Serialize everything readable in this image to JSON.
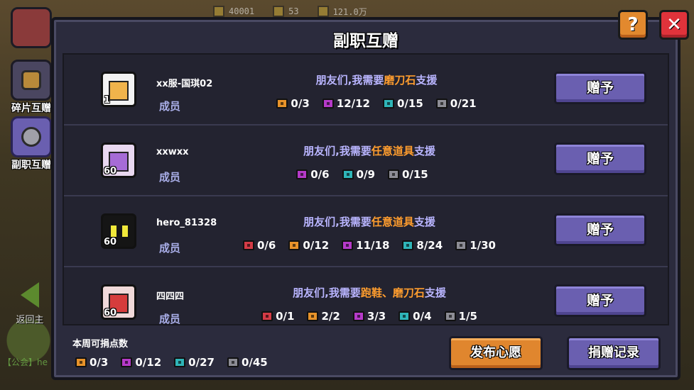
{
  "top_bar": {
    "resources": [
      {
        "icon": "gem-icon",
        "value": "40001"
      },
      {
        "icon": "key-icon",
        "value": "53"
      },
      {
        "icon": "coin-icon",
        "value": "121.0万"
      }
    ]
  },
  "side_tabs": [
    {
      "label": "碎片互赠",
      "icon": "shield-icon",
      "active": false
    },
    {
      "label": "副职互赠",
      "icon": "gear-stone-icon",
      "active": true
    }
  ],
  "back_label": "返回主",
  "guild_chat": "【公会】he",
  "dialog": {
    "title": "副职互赠",
    "rows": [
      {
        "name": "xx服-国琪02",
        "level": "1",
        "role": "成员",
        "need_prefix": "朋友们,我需要",
        "need_item": "磨刀石",
        "need_suffix": "支援",
        "counts": [
          {
            "color": "orange",
            "value": "0/3"
          },
          {
            "color": "purple",
            "value": "12/12"
          },
          {
            "color": "teal",
            "value": "0/15"
          },
          {
            "color": "gray",
            "value": "0/21"
          }
        ],
        "button": "赠予"
      },
      {
        "name": "xxwxx",
        "level": "60",
        "role": "成员",
        "need_prefix": "朋友们,我需要",
        "need_item": "任意道具",
        "need_suffix": "支援",
        "counts": [
          {
            "color": "purple",
            "value": "0/6"
          },
          {
            "color": "teal",
            "value": "0/9"
          },
          {
            "color": "gray",
            "value": "0/15"
          }
        ],
        "button": "赠予"
      },
      {
        "name": "hero_81328",
        "level": "60",
        "role": "成员",
        "need_prefix": "朋友们,我需要",
        "need_item": "任意道具",
        "need_suffix": "支援",
        "counts": [
          {
            "color": "red",
            "value": "0/6"
          },
          {
            "color": "orange",
            "value": "0/12"
          },
          {
            "color": "purple",
            "value": "11/18"
          },
          {
            "color": "teal",
            "value": "8/24"
          },
          {
            "color": "gray",
            "value": "1/30"
          }
        ],
        "button": "赠予"
      },
      {
        "name": "四四四",
        "level": "60",
        "role": "成员",
        "need_prefix": "朋友们,我需要",
        "need_item": "跑鞋、磨刀石",
        "need_suffix": "支援",
        "counts": [
          {
            "color": "red",
            "value": "0/1"
          },
          {
            "color": "orange",
            "value": "2/2"
          },
          {
            "color": "purple",
            "value": "3/3"
          },
          {
            "color": "teal",
            "value": "0/4"
          },
          {
            "color": "gray",
            "value": "1/5"
          }
        ],
        "button": "赠予"
      }
    ],
    "weekly_label": "本周可捐点数",
    "weekly_counts": [
      {
        "color": "orange",
        "value": "0/3"
      },
      {
        "color": "purple",
        "value": "0/12"
      },
      {
        "color": "teal",
        "value": "0/27"
      },
      {
        "color": "gray",
        "value": "0/45"
      }
    ],
    "publish_button": "发布心愿",
    "record_button": "捐赠记录",
    "help_label": "?",
    "close_label": "✕"
  }
}
